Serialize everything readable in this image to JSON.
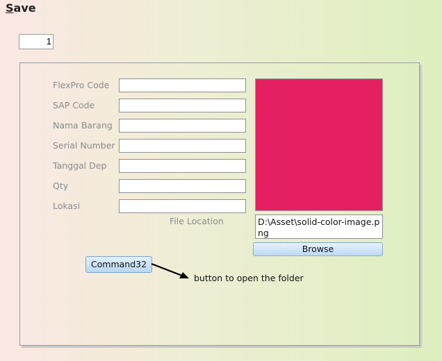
{
  "header": {
    "save_label_underlined": "S",
    "save_label_rest": "ave"
  },
  "record_number": "1",
  "form": {
    "fields": [
      {
        "label": "FlexPro Code",
        "value": ""
      },
      {
        "label": "SAP Code",
        "value": ""
      },
      {
        "label": "Nama Barang",
        "value": ""
      },
      {
        "label": "Serial Number",
        "value": ""
      },
      {
        "label": "Tanggal Dep",
        "value": ""
      },
      {
        "label": "Qty",
        "value": ""
      },
      {
        "label": "Lokasi",
        "value": ""
      }
    ],
    "file_location_label": "File Location",
    "file_path": "D:\\Asset\\solid-color-image.png",
    "image_color": "#e52062",
    "browse_label": "Browse",
    "command_label": "Command32"
  },
  "annotation": {
    "text": "button to open the folder"
  }
}
